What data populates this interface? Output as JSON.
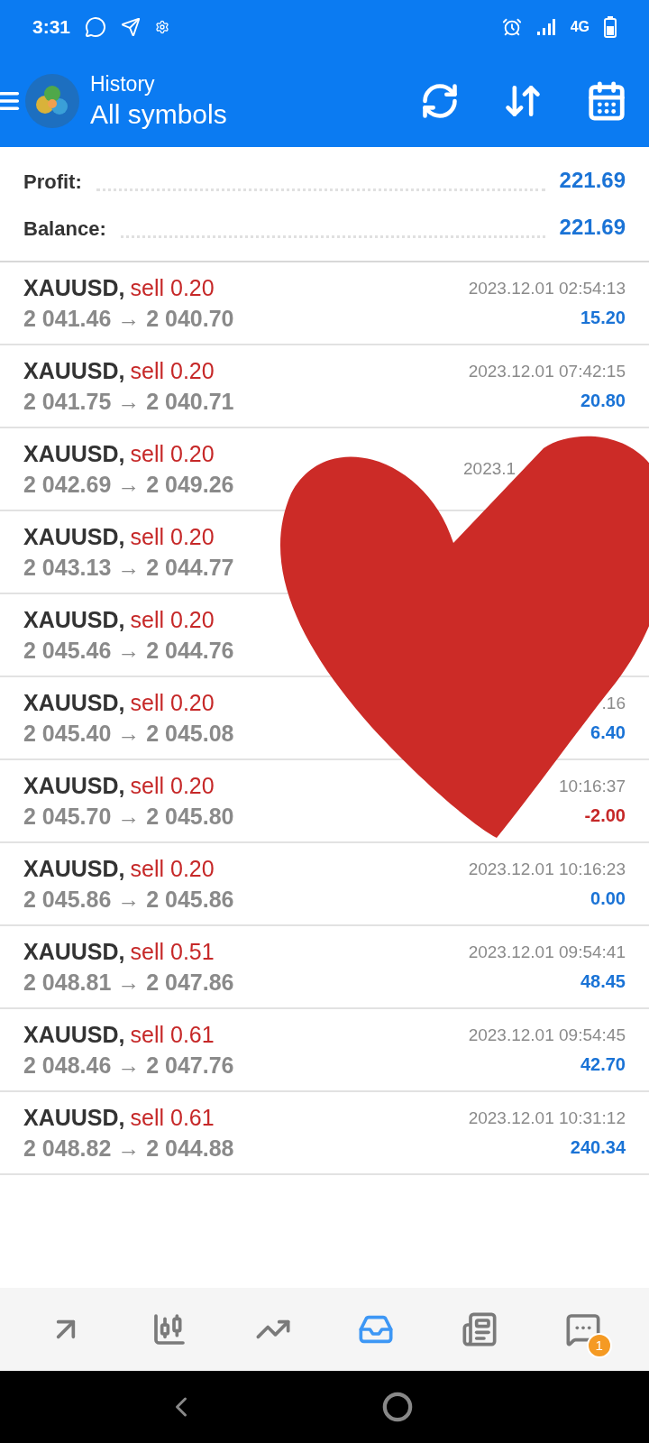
{
  "status_bar": {
    "time": "3:31",
    "network": "4G"
  },
  "app_bar": {
    "title": "History",
    "subtitle": "All symbols"
  },
  "summary": [
    {
      "label": "Profit:",
      "value": "221.69"
    },
    {
      "label": "Balance:",
      "value": "221.69"
    }
  ],
  "deals": [
    {
      "symbol": "XAUUSD,",
      "side": "sell 0.20",
      "prices": "2 041.46 → 2 040.70",
      "time": "2023.12.01 02:54:13",
      "profit": "15.20",
      "loss": false
    },
    {
      "symbol": "XAUUSD,",
      "side": "sell 0.20",
      "prices": "2 041.75 → 2 040.71",
      "time": "2023.12.01 07:42:15",
      "profit": "20.80",
      "loss": false
    },
    {
      "symbol": "XAUUSD,",
      "side": "sell 0.20",
      "prices": "2 042.69 → 2 049.26",
      "time": "2023.1",
      "truncated": true
    },
    {
      "symbol": "XAUUSD,",
      "side": "sell 0.20",
      "prices": "2 043.13 → 2 044.77"
    },
    {
      "symbol": "XAUUSD,",
      "side": "sell 0.20",
      "prices": "2 045.46 → 2 044.76"
    },
    {
      "symbol": "XAUUSD,",
      "side": "sell 0.20",
      "prices": "2 045.40 → 2 045.08",
      "time": ".16",
      "profit": "6.40",
      "loss": false
    },
    {
      "symbol": "XAUUSD,",
      "side": "sell 0.20",
      "prices": "2 045.70 → 2 045.80",
      "time": "10:16:37",
      "profit": "-2.00",
      "loss": true
    },
    {
      "symbol": "XAUUSD,",
      "side": "sell 0.20",
      "prices": "2 045.86 → 2 045.86",
      "time": "2023.12.01 10:16:23",
      "profit": "0.00",
      "loss": false
    },
    {
      "symbol": "XAUUSD,",
      "side": "sell 0.51",
      "prices": "2 048.81 → 2 047.86",
      "time": "2023.12.01 09:54:41",
      "profit": "48.45",
      "loss": false
    },
    {
      "symbol": "XAUUSD,",
      "side": "sell 0.61",
      "prices": "2 048.46 → 2 047.76",
      "time": "2023.12.01 09:54:45",
      "profit": "42.70",
      "loss": false
    },
    {
      "symbol": "XAUUSD,",
      "side": "sell 0.61",
      "prices": "2 048.82 → 2 044.88",
      "time": "2023.12.01 10:31:12",
      "profit": "240.34",
      "loss": false
    }
  ],
  "overlay": {
    "kind": "heart"
  },
  "bottom_nav": [
    {
      "kind": "quotes",
      "selected": false
    },
    {
      "kind": "chart",
      "selected": false
    },
    {
      "kind": "trade",
      "selected": false
    },
    {
      "kind": "history",
      "selected": true
    },
    {
      "kind": "news",
      "selected": false
    },
    {
      "kind": "chat",
      "selected": false,
      "badge": "1"
    }
  ]
}
